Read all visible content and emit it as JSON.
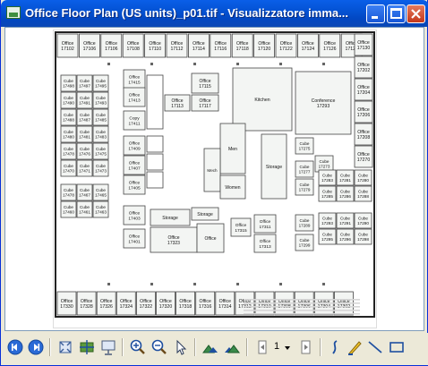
{
  "window": {
    "title": "Office Floor Plan (US units)_p01.tif - Visualizzatore imma...",
    "minimize_icon": "minimize-icon",
    "maximize_icon": "maximize-icon",
    "close_icon": "close-icon"
  },
  "plan": {
    "top_row": [
      {
        "name": "Office",
        "num": "17102"
      },
      {
        "name": "Office",
        "num": "17106"
      },
      {
        "name": "Office",
        "num": "17106"
      },
      {
        "name": "Office",
        "num": "17108"
      },
      {
        "name": "Office",
        "num": "17110"
      },
      {
        "name": "Office",
        "num": "17112"
      },
      {
        "name": "Office",
        "num": "17114"
      },
      {
        "name": "Office",
        "num": "17116"
      },
      {
        "name": "Office",
        "num": "17118"
      },
      {
        "name": "Office",
        "num": "17120"
      },
      {
        "name": "Office",
        "num": "17122"
      },
      {
        "name": "Office",
        "num": "17124"
      },
      {
        "name": "Office",
        "num": "17126"
      },
      {
        "name": "Office",
        "num": "17128"
      }
    ],
    "bottom_row": [
      {
        "name": "Office",
        "num": "17330"
      },
      {
        "name": "Office",
        "num": "17328"
      },
      {
        "name": "Office",
        "num": "17326"
      },
      {
        "name": "Office",
        "num": "17324"
      },
      {
        "name": "Office",
        "num": "17322"
      },
      {
        "name": "Office",
        "num": "17320"
      },
      {
        "name": "Office",
        "num": "17318"
      },
      {
        "name": "Office",
        "num": "17316"
      },
      {
        "name": "Office",
        "num": "17314"
      },
      {
        "name": "Office",
        "num": "17312"
      },
      {
        "name": "Office",
        "num": "17310"
      },
      {
        "name": "Office",
        "num": "17308"
      },
      {
        "name": "Office",
        "num": "17306"
      },
      {
        "name": "Office",
        "num": "17304"
      },
      {
        "name": "Office",
        "num": "17302"
      }
    ],
    "right_col": [
      {
        "name": "Office",
        "num": "17130"
      },
      {
        "name": "Office",
        "num": "17202"
      },
      {
        "name": "Office",
        "num": "17204"
      },
      {
        "name": "Office",
        "num": "17206"
      },
      {
        "name": "Office",
        "num": "17208"
      },
      {
        "name": "Office",
        "num": "17270"
      }
    ],
    "left_cubes": [
      {
        "name": "Cube",
        "num": "17498"
      },
      {
        "name": "Cube",
        "num": "17497"
      },
      {
        "name": "Cube",
        "num": "17495"
      },
      {
        "name": "Cube",
        "num": "17490"
      },
      {
        "name": "Cube",
        "num": "17491"
      },
      {
        "name": "Cube",
        "num": "17493"
      },
      {
        "name": "Cube",
        "num": "17488"
      },
      {
        "name": "Cube",
        "num": "17487"
      },
      {
        "name": "Cube",
        "num": "17485"
      },
      {
        "name": "Cube",
        "num": "17480"
      },
      {
        "name": "Cube",
        "num": "17481"
      },
      {
        "name": "Cube",
        "num": "17483"
      },
      {
        "name": "Cube",
        "num": "17478"
      },
      {
        "name": "Cube",
        "num": "17476"
      },
      {
        "name": "Cube",
        "num": "17475"
      },
      {
        "name": "Cube",
        "num": "17470"
      },
      {
        "name": "Cube",
        "num": "17471"
      },
      {
        "name": "Cube",
        "num": "17473"
      },
      {
        "name": "Cube",
        "num": "17478"
      },
      {
        "name": "Cube",
        "num": "17467"
      },
      {
        "name": "Cube",
        "num": "17465"
      },
      {
        "name": "Cube",
        "num": "17460"
      },
      {
        "name": "Cube",
        "num": "17461"
      },
      {
        "name": "Cube",
        "num": "17463"
      }
    ],
    "inner_left": [
      {
        "name": "Office",
        "num": "17415"
      },
      {
        "name": "Office",
        "num": "17413"
      },
      {
        "name": "Copy",
        "num": "17411"
      },
      {
        "name": "Office",
        "num": "17409"
      },
      {
        "name": "Office",
        "num": "17407"
      },
      {
        "name": "Office",
        "num": "17405"
      },
      {
        "name": "Office",
        "num": "17403"
      },
      {
        "name": "Office",
        "num": "17401"
      }
    ],
    "right_cubes": [
      {
        "name": "Cube",
        "num": "17283"
      },
      {
        "name": "Cube",
        "num": "17281"
      },
      {
        "name": "Cube",
        "num": "17280"
      },
      {
        "name": "Cube",
        "num": "17285"
      },
      {
        "name": "Cube",
        "num": "17286"
      },
      {
        "name": "Cube",
        "num": "17288"
      },
      {
        "name": "Cube",
        "num": "17293"
      },
      {
        "name": "Cube",
        "num": "17291"
      },
      {
        "name": "Cube",
        "num": "17290"
      },
      {
        "name": "Cube",
        "num": "17295"
      },
      {
        "name": "Cube",
        "num": "17296"
      },
      {
        "name": "Cube",
        "num": "17298"
      }
    ],
    "right_mid_cubes": [
      {
        "name": "Cube",
        "num": "17275"
      },
      {
        "name": "Cube",
        "num": "17273"
      },
      {
        "name": "Cube",
        "num": "17277"
      },
      {
        "name": "Cube",
        "num": "17279"
      },
      {
        "name": "Cube",
        "num": "17289"
      },
      {
        "name": "Cube",
        "num": "17299"
      }
    ],
    "rooms": {
      "kitchen": "Kitchen",
      "conference": "Conference",
      "conference_num": "17293",
      "storage": "Storage",
      "men": "Men",
      "women": "Women",
      "mech": "Mech",
      "storage_left": "Storage",
      "storage_mid": "Storage",
      "office_17323": "Office",
      "office_17323_num": "17323",
      "office_center": "Office",
      "office_17115": "Office",
      "office_17115_num": "17115",
      "office_17117": "Office",
      "office_17117_num": "17117",
      "office_17113": "Office",
      "office_17113_num": "17113",
      "office_17315": "Office",
      "office_17315_num": "17315",
      "office_17311": "Office",
      "office_17311_num": "17311",
      "office_17313": "Office",
      "office_17313_num": "17313"
    }
  },
  "toolbar": {
    "page_number": "1",
    "icons": [
      "previous-image-icon",
      "next-image-icon",
      "best-fit-icon",
      "actual-size-icon",
      "slideshow-icon",
      "zoom-in-icon",
      "zoom-out-icon",
      "pointer-icon",
      "rotate-clockwise-icon",
      "rotate-counterclockwise-icon",
      "first-page-icon",
      "page-dropdown-icon",
      "last-page-icon",
      "pen-icon",
      "highlighter-icon",
      "line-icon",
      "rectangle-icon"
    ]
  }
}
